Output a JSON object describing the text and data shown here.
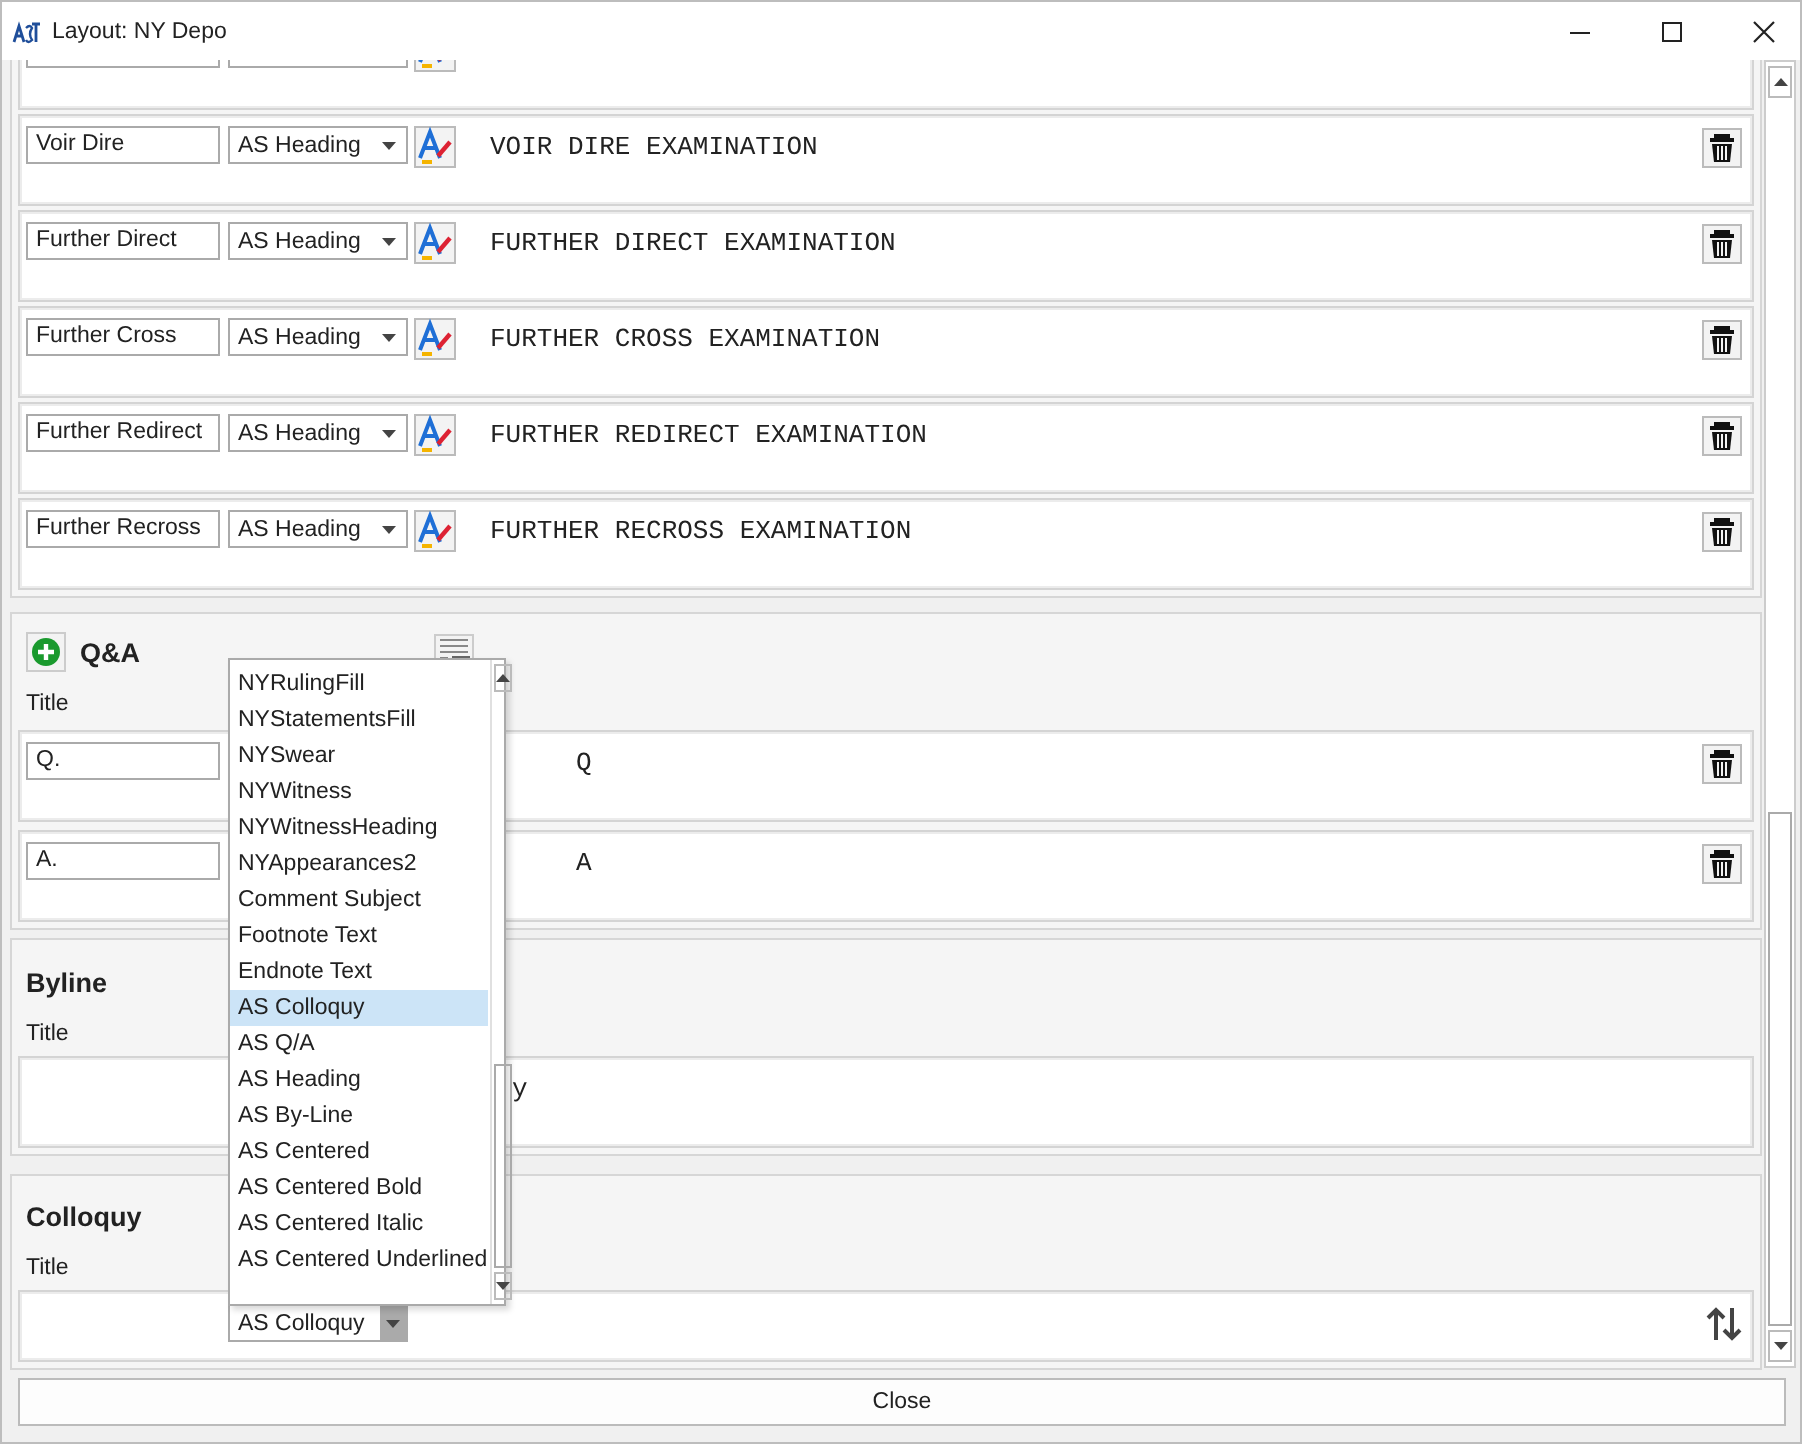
{
  "window": {
    "title": "Layout: NY Depo"
  },
  "sections": [
    {
      "kind": "list",
      "rows": [
        {
          "kind": "clipped"
        },
        {
          "kind": "full",
          "title": "Voir Dire",
          "style": "AS Heading",
          "preview": "VOIR DIRE EXAMINATION",
          "deletable": true
        },
        {
          "kind": "full",
          "title": "Further Direct",
          "style": "AS Heading",
          "preview": "FURTHER DIRECT EXAMINATION",
          "deletable": true
        },
        {
          "kind": "full",
          "title": "Further Cross",
          "style": "AS Heading",
          "preview": "FURTHER CROSS EXAMINATION",
          "deletable": true
        },
        {
          "kind": "full",
          "title": "Further Redirect",
          "style": "AS Heading",
          "preview": "FURTHER REDIRECT EXAMINATION",
          "deletable": true
        },
        {
          "kind": "full",
          "title": "Further Recross",
          "style": "AS Heading",
          "preview": "FURTHER RECROSS EXAMINATION",
          "deletable": true
        }
      ]
    },
    {
      "kind": "group",
      "title": "Q&A",
      "addable": true,
      "field_label": "Title",
      "rows": [
        {
          "kind": "covered",
          "title": "Q.",
          "preview": "Q",
          "deletable": true
        },
        {
          "kind": "covered",
          "title": "A.",
          "preview": "A",
          "deletable": true
        }
      ]
    },
    {
      "kind": "group",
      "title": "Byline",
      "addable": false,
      "field_label": "Title",
      "rows": [
        {
          "kind": "covered",
          "preview": "y"
        }
      ]
    },
    {
      "kind": "group",
      "title": "Colloquy",
      "addable": false,
      "field_label": "Title",
      "rows": [
        {
          "kind": "open",
          "style": "AS Colloquy",
          "reorderable": true
        }
      ]
    }
  ],
  "dropdown": {
    "items": [
      {
        "label": "NYRulingFill",
        "selected": false
      },
      {
        "label": "NYStatementsFill",
        "selected": false
      },
      {
        "label": "NYSwear",
        "selected": false
      },
      {
        "label": "NYWitness",
        "selected": false
      },
      {
        "label": "NYWitnessHeading",
        "selected": false
      },
      {
        "label": "NYAppearances2",
        "selected": false
      },
      {
        "label": "Comment Subject",
        "selected": false
      },
      {
        "label": "Footnote Text",
        "selected": false
      },
      {
        "label": "Endnote Text",
        "selected": false
      },
      {
        "label": "AS Colloquy",
        "selected": true
      },
      {
        "label": "AS Q/A",
        "selected": false
      },
      {
        "label": "AS Heading",
        "selected": false
      },
      {
        "label": "AS By-Line",
        "selected": false
      },
      {
        "label": "AS Centered",
        "selected": false
      },
      {
        "label": "AS Centered Bold",
        "selected": false
      },
      {
        "label": "AS Centered Italic",
        "selected": false
      },
      {
        "label": "AS Centered Underlined",
        "selected": false
      }
    ]
  },
  "close_button": "Close"
}
